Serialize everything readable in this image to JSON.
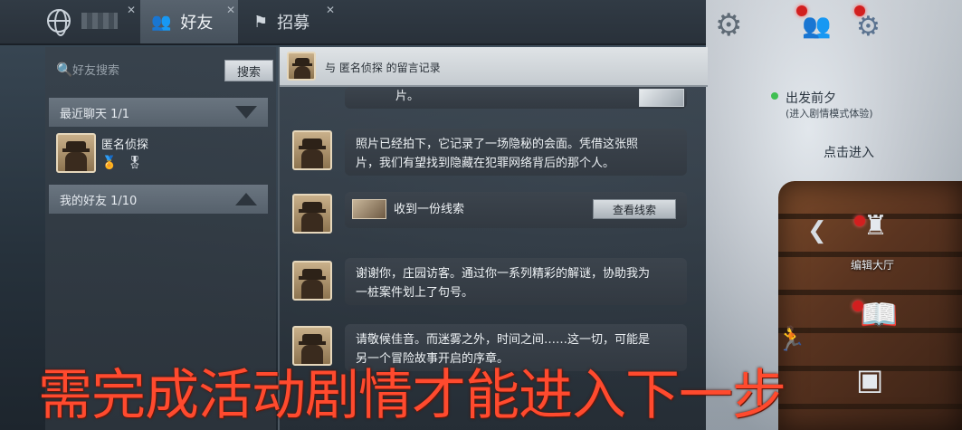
{
  "topbar": {
    "tabs": [
      {
        "label": "好友",
        "icon": "friends-icon",
        "active": true
      },
      {
        "label": "招募",
        "icon": "flag-icon",
        "active": false
      }
    ]
  },
  "sidebar": {
    "search": {
      "placeholder": "好友搜索",
      "button_label": "搜索"
    },
    "recent_chats": {
      "label": "最近聊天 1/1"
    },
    "friends_section": {
      "label": "我的好友 1/10"
    },
    "friends": [
      {
        "name": "匿名侦探",
        "avatar": "detective-avatar"
      }
    ]
  },
  "chat": {
    "header": {
      "text": "与  匿名侦探  的留言记录"
    },
    "partial_message": "片。",
    "messages": [
      {
        "type": "text",
        "text_line1": "照片已经拍下，它记录了一场隐秘的会面。凭借这张照",
        "text_line2": "片，我们有望找到隐藏在犯罪网络背后的那个人。"
      },
      {
        "type": "clue",
        "text": "收到一份线索",
        "button_label": "查看线索"
      },
      {
        "type": "text",
        "text_line1": "谢谢你，庄园访客。通过你一系列精彩的解谜，协助我为",
        "text_line2": "一桩案件划上了句号。"
      },
      {
        "type": "text",
        "text_line1": "请敬候佳音。而迷雾之外，时间之间……这一切，可能是",
        "text_line2": "另一个冒险故事开启的序章。"
      }
    ]
  },
  "right_panel": {
    "event": {
      "title": "出发前夕",
      "subtitle": "(进入剧情模式体验)",
      "enter_label": "点击进入"
    },
    "edit_hall_label": "编辑大厅",
    "colors": {
      "notify_dot": "#d21f1f",
      "online_dot": "#3fbf52"
    }
  },
  "caption": {
    "text": "需完成活动剧情才能进入下一步",
    "color": "#ff4a2e"
  }
}
